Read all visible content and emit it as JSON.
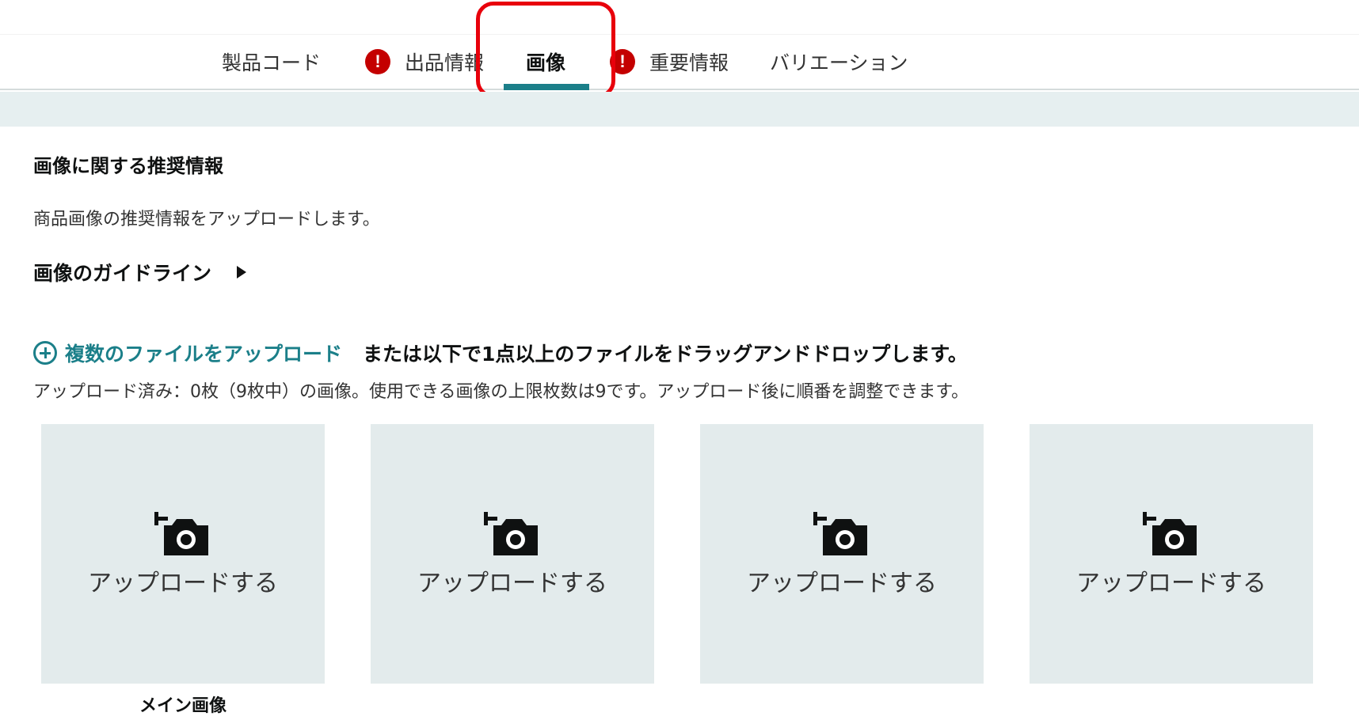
{
  "tabs": [
    {
      "label": "製品コード",
      "warning": false,
      "active": false
    },
    {
      "label": "出品情報",
      "warning": true,
      "active": false
    },
    {
      "label": "画像",
      "warning": false,
      "active": true
    },
    {
      "label": "重要情報",
      "warning": true,
      "active": false
    },
    {
      "label": "バリエーション",
      "warning": false,
      "active": false
    }
  ],
  "warning_glyph": "!",
  "colors": {
    "accent": "#1b7f89",
    "warning": "#c40000",
    "highlight": "#e8000b",
    "tile_bg": "#e3ebec",
    "band": "#e6eff0"
  },
  "recommend": {
    "heading": "画像に関する推奨情報",
    "description": "商品画像の推奨情報をアップロードします。",
    "guideline_label": "画像のガイドライン"
  },
  "upload": {
    "link_label": "複数のファイルをアップロード",
    "tail_text": "または以下で1点以上のファイルをドラッグアンドドロップします。",
    "count_text": "アップロード済み：0枚（9枚中）の画像。使用できる画像の上限枚数は9です。アップロード後に順番を調整できます。"
  },
  "tiles": [
    {
      "label": "アップロードする",
      "icon": "add-photo-icon"
    },
    {
      "label": "アップロードする",
      "icon": "add-photo-icon"
    },
    {
      "label": "アップロードする",
      "icon": "add-photo-icon"
    },
    {
      "label": "アップロードする",
      "icon": "add-photo-icon"
    }
  ],
  "main_image_label": "メイン画像"
}
